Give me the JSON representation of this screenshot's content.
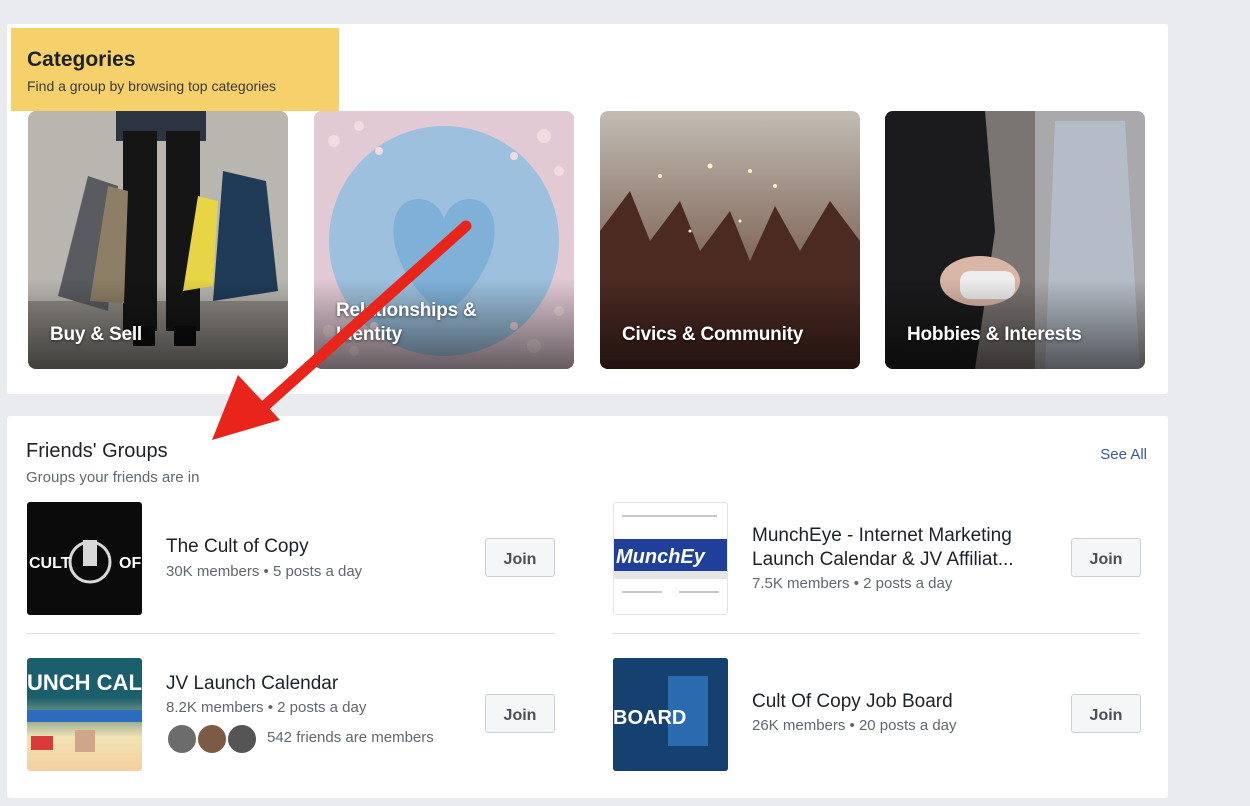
{
  "categories": {
    "title": "Categories",
    "subtitle": "Find a group by browsing top categories",
    "tiles": [
      {
        "label": "Buy & Sell"
      },
      {
        "label": "Relationships &\nIdentity"
      },
      {
        "label": "Civics & Community"
      },
      {
        "label": "Hobbies & Interests"
      }
    ]
  },
  "friends_groups": {
    "title": "Friends' Groups",
    "subtitle": "Groups your friends are in",
    "see_all": "See All",
    "groups": [
      {
        "name": "The Cult of Copy",
        "meta": "30K members • 5 posts a day",
        "join": "Join",
        "thumb_text": "CULT   OF"
      },
      {
        "name": "MunchEye - Internet Marketing\nLaunch Calendar & JV Affiliat...",
        "meta": "7.5K members • 2 posts a day",
        "join": "Join",
        "thumb_text": "MunchEy"
      },
      {
        "name": "JV Launch Calendar",
        "meta": "8.2K members • 2 posts a day",
        "friends": "542 friends are members",
        "join": "Join",
        "thumb_text": "UNCH CALEN"
      },
      {
        "name": "Cult Of Copy Job Board",
        "meta": "26K members • 20 posts a day",
        "join": "Join",
        "thumb_text": "BOARD"
      }
    ]
  },
  "colors": {
    "heading_bg": "#f6d06a",
    "link": "#365899",
    "arrow": "#e8241b"
  }
}
